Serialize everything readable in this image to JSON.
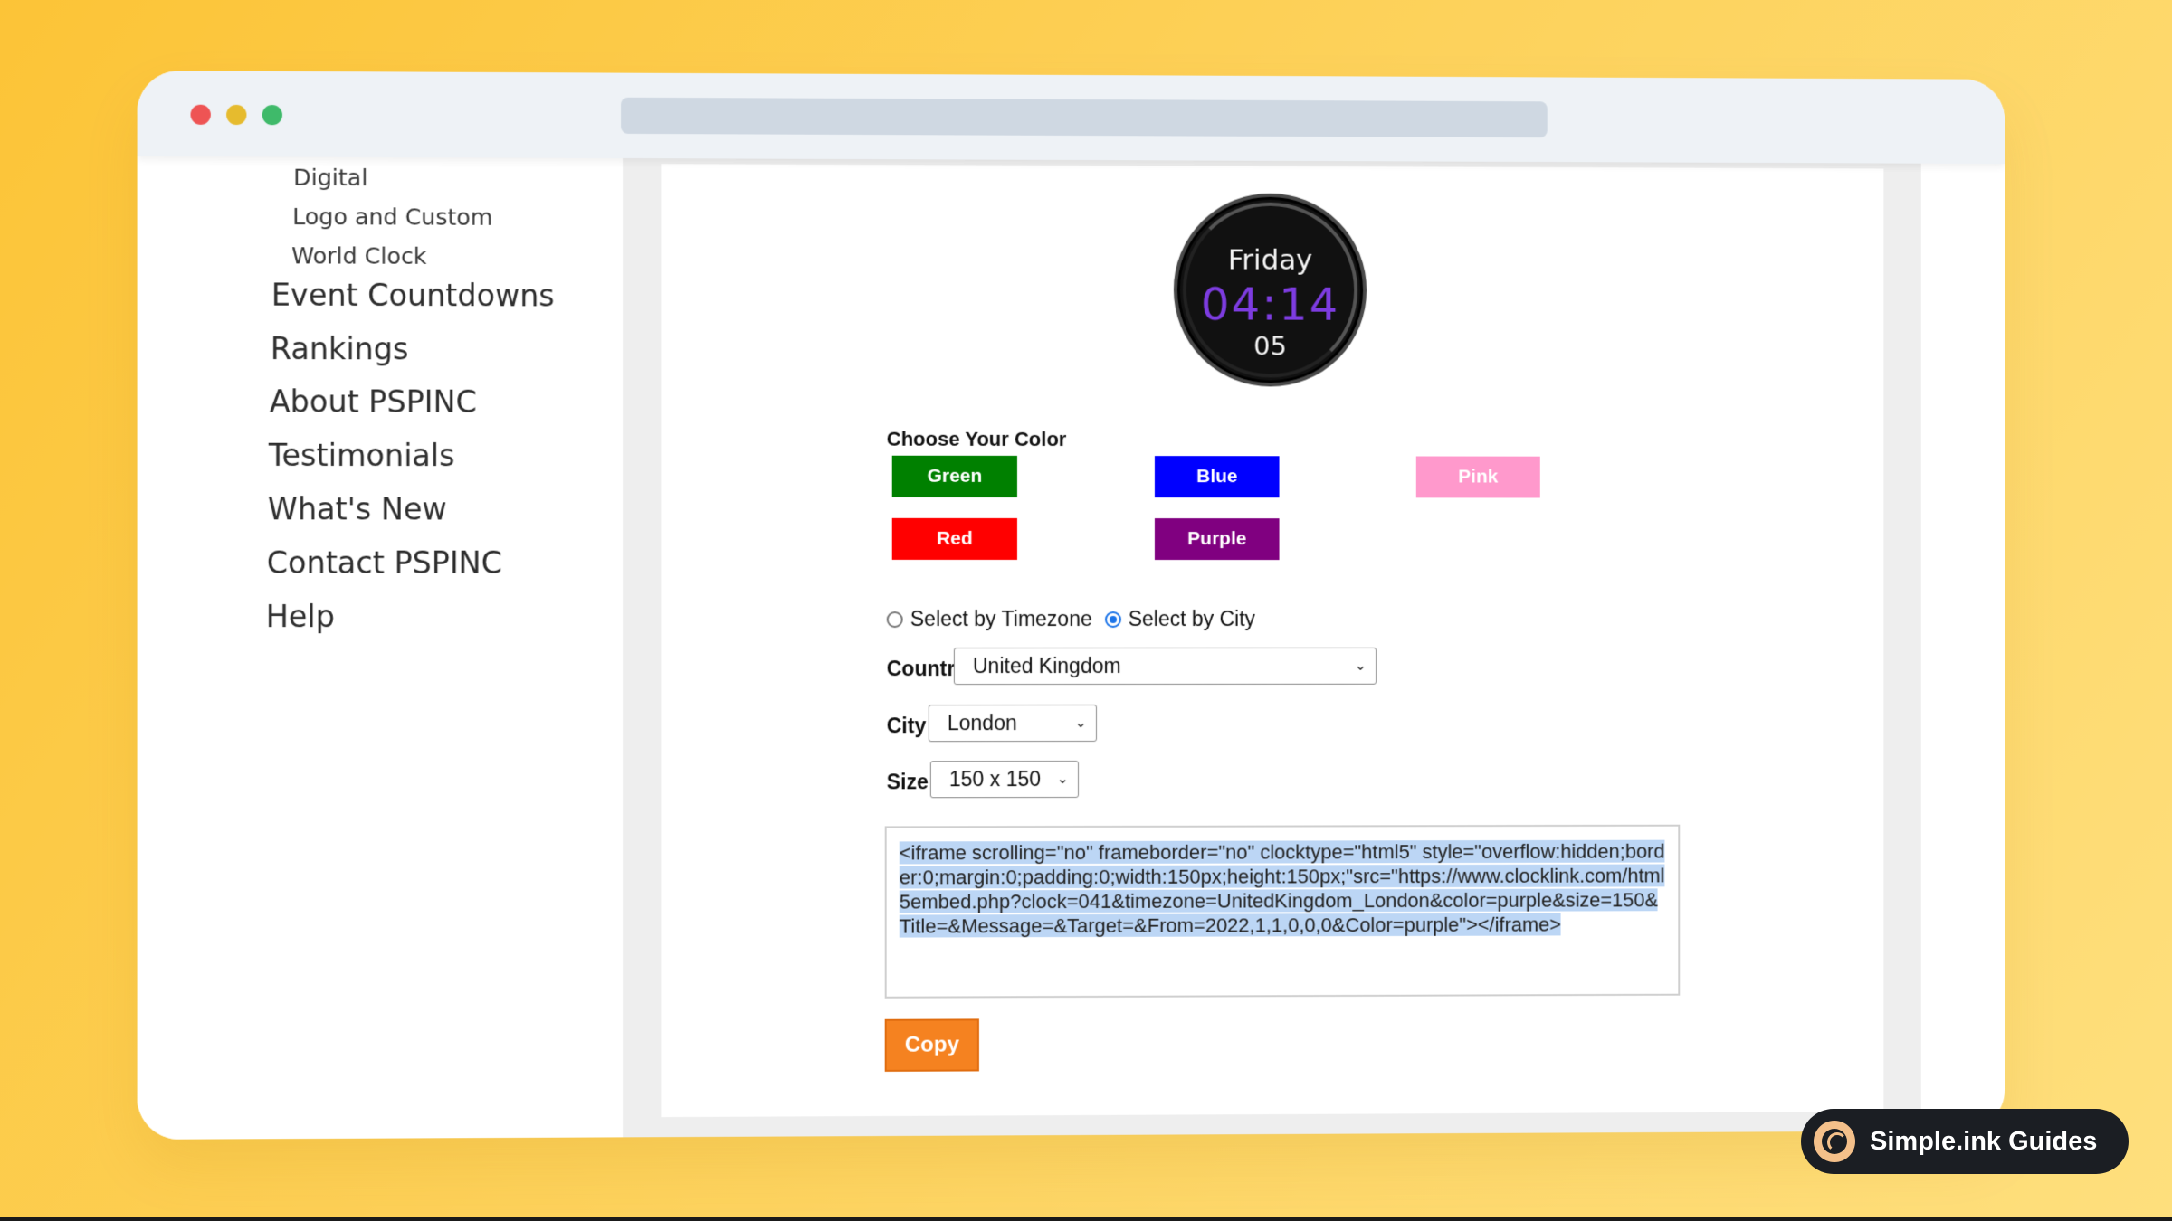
{
  "sidebar": {
    "sub_items": [
      "Digital",
      "Logo and Custom",
      "World Clock"
    ],
    "main_items": [
      "Event Countdowns",
      "Rankings",
      "About PSPINC",
      "Testimonials",
      "What's New",
      "Contact PSPINC",
      "Help"
    ]
  },
  "clock": {
    "day": "Friday",
    "time": "04:14",
    "seconds": "05",
    "time_color": "#7d3ce0"
  },
  "color_picker": {
    "label": "Choose Your Color",
    "buttons": [
      {
        "label": "Green",
        "color": "#008000"
      },
      {
        "label": "Blue",
        "color": "#0000ff"
      },
      {
        "label": "Pink",
        "color": "#ff99cc"
      },
      {
        "label": "Red",
        "color": "#ff0000"
      },
      {
        "label": "Purple",
        "color": "#800080"
      }
    ]
  },
  "selection": {
    "option_timezone": "Select by Timezone",
    "option_city": "Select by City",
    "selected": "Select by City"
  },
  "form": {
    "country_label": "Country",
    "country_value": "United Kingdom",
    "city_label": "City",
    "city_value": "London",
    "size_label": "Size",
    "size_value": "150 x 150"
  },
  "embed_code": "<iframe scrolling=\"no\" frameborder=\"no\" clocktype=\"html5\" style=\"overflow:hidden;border:0;margin:0;padding:0;width:150px;height:150px;\"src=\"https://www.clocklink.com/html5embed.php?clock=041&timezone=UnitedKingdom_London&color=purple&size=150&Title=&Message=&Target=&From=2022,1,1,0,0,0&Color=purple\"></iframe>",
  "copy_label": "Copy",
  "badge": {
    "text": "Simple.ink Guides"
  }
}
